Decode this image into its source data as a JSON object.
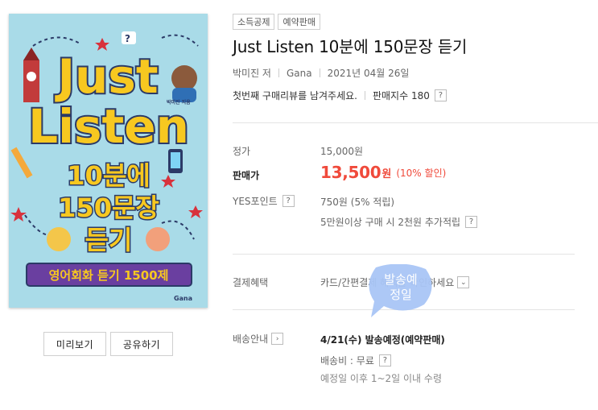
{
  "cover": {
    "title_line1": "Just",
    "title_line2": "Listen",
    "subtitle_line1": "10분에",
    "subtitle_line2": "150문장",
    "subtitle_line3": "듣기",
    "author_small": "박미진 지음",
    "banner": "영어회화 듣기 1500제",
    "publisher": "Gana"
  },
  "buttons": {
    "preview": "미리보기",
    "share": "공유하기"
  },
  "tags": [
    "소득공제",
    "예약판매"
  ],
  "title": "Just Listen 10분에 150문장 듣기",
  "meta": {
    "author": "박미진 저",
    "publisher": "Gana",
    "date": "2021년 04월 26일"
  },
  "review": {
    "text": "첫번째 구매리뷰를 남겨주세요.",
    "sales_index": "판매지수 180"
  },
  "price": {
    "list_label": "정가",
    "list_value": "15,000원",
    "sale_label": "판매가",
    "sale_value": "13,500",
    "sale_unit": "원",
    "discount": "(10% 할인)",
    "points_label": "YES포인트",
    "points_value": "750원 (5% 적립)",
    "bonus_text": "5만원이상 구매 시 2천원 추가적립"
  },
  "benefit": {
    "label": "결제혜택",
    "value": "카드/간편결제 혜택을 확인하세요"
  },
  "shipping": {
    "label": "배송안내",
    "date": "4/21(수) 발송예정(예약판매)",
    "fee": "배송비 : 무료",
    "note": "예정일 이후 1~2일 이내 수령"
  },
  "bubble": {
    "line1": "발송예",
    "line2": "정일"
  },
  "icons": [
    "question-icon",
    "chevron-right-icon",
    "chevron-down-icon"
  ],
  "colors": {
    "price_red": "#f04a3b",
    "bubble_blue": "#a9c5f5",
    "cover_bg": "#a9dbe8",
    "title_yellow": "#f7c820"
  }
}
